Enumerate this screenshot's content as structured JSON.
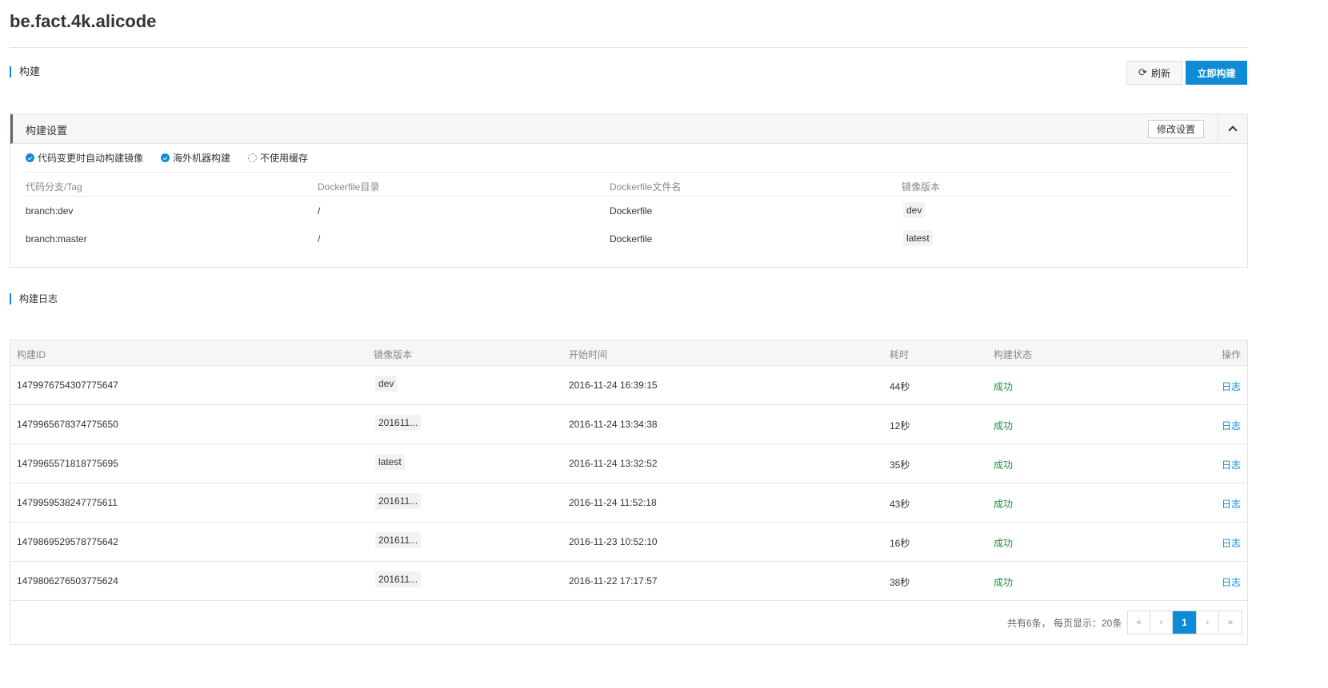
{
  "page": {
    "title": "be.fact.4k.alicode"
  },
  "build": {
    "heading": "构建",
    "refresh_label": "刷新",
    "build_now_label": "立即构建"
  },
  "settings": {
    "title": "构建设置",
    "edit_label": "修改设置",
    "options": [
      {
        "label": "代码变更时自动构建镜像",
        "checked": true
      },
      {
        "label": "海外机器构建",
        "checked": true
      },
      {
        "label": "不使用缓存",
        "checked": false
      }
    ],
    "columns": [
      "代码分支/Tag",
      "Dockerfile目录",
      "Dockerfile文件名",
      "镜像版本"
    ],
    "rules": [
      {
        "branch": "branch:dev",
        "dir": "/",
        "file": "Dockerfile",
        "version": "dev"
      },
      {
        "branch": "branch:master",
        "dir": "/",
        "file": "Dockerfile",
        "version": "latest"
      }
    ]
  },
  "logs": {
    "heading": "构建日志",
    "columns": [
      "构建ID",
      "镜像版本",
      "开始时间",
      "耗时",
      "构建状态",
      "操作"
    ],
    "rows": [
      {
        "id": "1479976754307775647",
        "version": "dev",
        "start": "2016-11-24 16:39:15",
        "duration": "44秒",
        "status": "成功",
        "action": "日志"
      },
      {
        "id": "1479965678374775650",
        "version": "201611...",
        "start": "2016-11-24 13:34:38",
        "duration": "12秒",
        "status": "成功",
        "action": "日志"
      },
      {
        "id": "1479965571818775695",
        "version": "latest",
        "start": "2016-11-24 13:32:52",
        "duration": "35秒",
        "status": "成功",
        "action": "日志"
      },
      {
        "id": "1479959538247775611",
        "version": "201611...",
        "start": "2016-11-24 11:52:18",
        "duration": "43秒",
        "status": "成功",
        "action": "日志"
      },
      {
        "id": "1479869529578775642",
        "version": "201611...",
        "start": "2016-11-23 10:52:10",
        "duration": "16秒",
        "status": "成功",
        "action": "日志"
      },
      {
        "id": "1479806276503775624",
        "version": "201611...",
        "start": "2016-11-22 17:17:57",
        "duration": "38秒",
        "status": "成功",
        "action": "日志"
      }
    ]
  },
  "pagination": {
    "info": "共有6条， 每页显示：20条",
    "first": "«",
    "prev": "‹",
    "current": "1",
    "next": "›",
    "last": "»"
  },
  "colors": {
    "accent": "#0e8bd6",
    "success": "#1e8e3e"
  },
  "icons": {
    "refresh": "refresh-icon",
    "collapse": "chevron-up-icon"
  }
}
